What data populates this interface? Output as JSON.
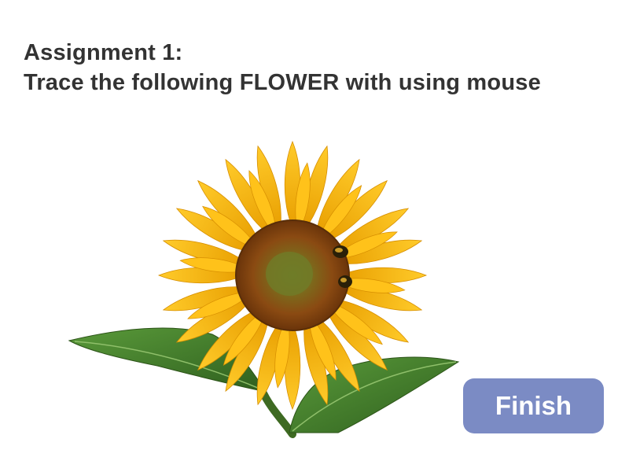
{
  "assignment": {
    "title": "Assignment 1:",
    "instruction": "Trace the following FLOWER with using mouse"
  },
  "finish_button": {
    "label": "Finish"
  },
  "colors": {
    "text": "#333333",
    "button_bg": "#7b8bc4",
    "button_text": "#ffffff",
    "petal": "#f4b400",
    "petal_dark": "#e39a00",
    "center_outer": "#7a3e0c",
    "center_inner": "#5b6b1f",
    "leaf": "#3e7a2a",
    "leaf_light": "#5e9a3c"
  },
  "image": {
    "subject": "sunflower-with-bees"
  }
}
